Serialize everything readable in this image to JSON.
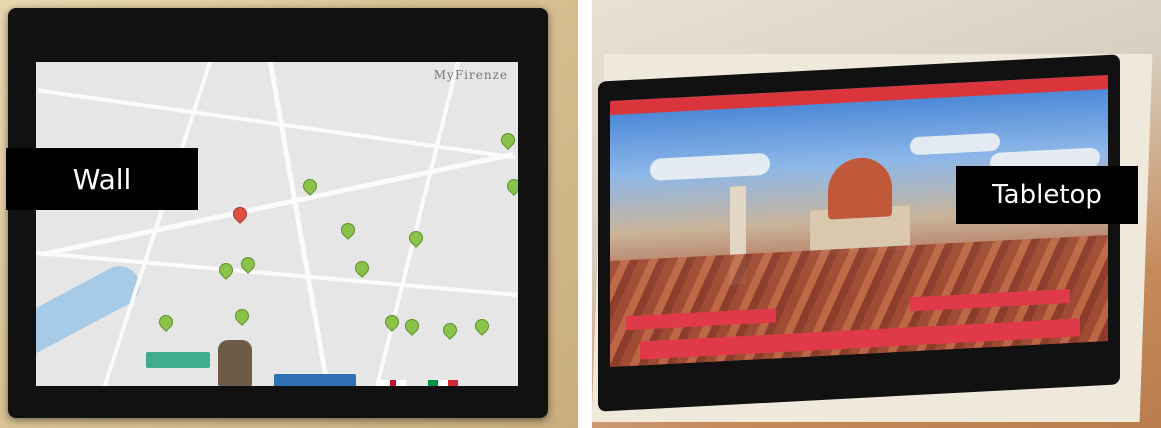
{
  "images": [
    {
      "label": "Wall",
      "brand": "MyFirenze"
    },
    {
      "label": "Tabletop"
    }
  ],
  "colors": {
    "label_bg": "#000000",
    "label_text": "#ffffff",
    "map_pin": "#8bc34a",
    "map_pin_active": "#e0513f",
    "tabletop_accent": "#e03a4a"
  },
  "icons": [
    "map-pin-icon",
    "uk-flag-icon",
    "italy-flag-icon"
  ]
}
